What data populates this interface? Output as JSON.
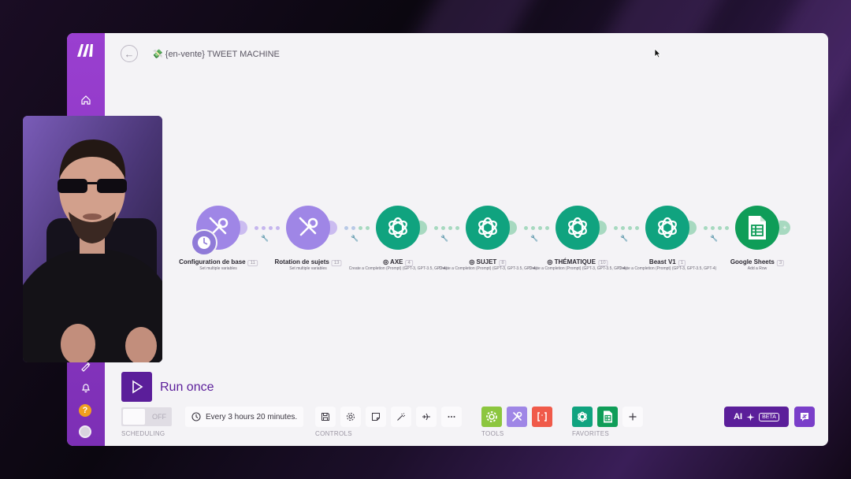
{
  "app": {
    "scenario_title": "{en-vente} TWEET MACHINE",
    "title_emoji": "💸"
  },
  "colors": {
    "sidebar": "#8a36c4",
    "brand_purple": "#5b1e9a",
    "openai_green": "#10a37f",
    "tools_purple": "#9f86e6",
    "sheets_green": "#0f9d58"
  },
  "flow": {
    "nodes": [
      {
        "label": "Configuration de base",
        "badge": "11",
        "sub": "Set multiple variables",
        "icon": "tools-icon",
        "kind": "purple"
      },
      {
        "label": "Rotation de sujets",
        "badge": "13",
        "sub": "Set multiple variables",
        "icon": "tools-icon",
        "kind": "purple"
      },
      {
        "label": "AXE",
        "badge": "4",
        "sub": "Create a Completion (Prompt) (GPT-3, GPT-3.5, GPT-4)",
        "icon": "openai-icon",
        "kind": "green"
      },
      {
        "label": "SUJET",
        "badge": "8",
        "sub": "Create a Completion (Prompt) (GPT-3, GPT-3.5, GPT-4)",
        "icon": "openai-icon",
        "kind": "green"
      },
      {
        "label": "THÉMATIQUE",
        "badge": "10",
        "sub": "Create a Completion (Prompt) (GPT-3, GPT-3.5, GPT-4)",
        "icon": "openai-icon",
        "kind": "green"
      },
      {
        "label": "Beast V1",
        "badge": "1",
        "sub": "Create a Completion (Prompt) (GPT-3, GPT-3.5, GPT-4)",
        "icon": "openai-icon",
        "kind": "green"
      },
      {
        "label": "Google Sheets",
        "badge": "3",
        "sub": "Add a Row",
        "icon": "sheets-icon",
        "kind": "sheets"
      }
    ]
  },
  "run": {
    "label": "Run once"
  },
  "scheduling": {
    "toggle_state": "OFF",
    "interval": "Every 3 hours 20 minutes.",
    "section_label": "SCHEDULING"
  },
  "controls": {
    "section_label": "CONTROLS"
  },
  "tools": {
    "section_label": "TOOLS"
  },
  "favorites": {
    "section_label": "FAVORITES"
  },
  "ai": {
    "label": "AI",
    "beta": "BETA"
  }
}
